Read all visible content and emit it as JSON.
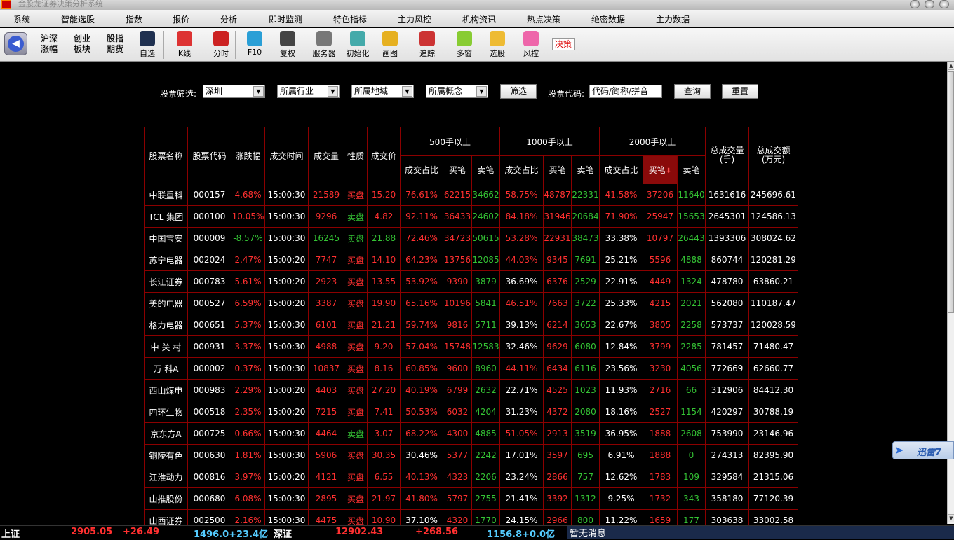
{
  "window": {
    "title": "金股龙证券决策分析系统"
  },
  "menu": [
    "系统",
    "智能选股",
    "指数",
    "报价",
    "分析",
    "即时监测",
    "特色指标",
    "主力风控",
    "机构资讯",
    "热点决策",
    "绝密数据",
    "主力数据"
  ],
  "toolbar": {
    "back_icon": "back-arrow-icon",
    "text_buttons": [
      {
        "label": "沪深\n涨幅"
      },
      {
        "label": "创业\n板块"
      },
      {
        "label": "股指\n期货"
      }
    ],
    "buttons": [
      {
        "label": "自选",
        "icon": "monitor-icon",
        "color": "#1f3050"
      },
      {
        "label": "K线",
        "icon": "candlestick-icon",
        "color": "#d33"
      },
      {
        "label": "分时",
        "icon": "line-chart-icon",
        "color": "#c22"
      },
      {
        "label": "F10",
        "icon": "snowflake-icon",
        "color": "#2a9fd6"
      },
      {
        "label": "复权",
        "icon": "printer-icon",
        "color": "#444"
      },
      {
        "label": "服务器",
        "icon": "gauge-icon",
        "color": "#777"
      },
      {
        "label": "初始化",
        "icon": "layers-icon",
        "color": "#4aa"
      },
      {
        "label": "画图",
        "icon": "palette-icon",
        "color": "#e6b020"
      },
      {
        "label": "追踪",
        "icon": "trend-icon",
        "color": "#c33"
      },
      {
        "label": "多窗",
        "icon": "globe-icon",
        "color": "#8c3"
      },
      {
        "label": "选股",
        "icon": "sparkle-icon",
        "color": "#eb3"
      },
      {
        "label": "风控",
        "icon": "target-icon",
        "color": "#e6a"
      }
    ],
    "decision_label": "决策"
  },
  "filter": {
    "screen_label": "股票筛选:",
    "market_select": "深圳",
    "industry_select": "所属行业",
    "region_select": "所属地域",
    "concept_select": "所属概念",
    "filter_button": "筛选",
    "code_label": "股票代码:",
    "code_placeholder": "代码/简称/拼音",
    "query_button": "查询",
    "reset_button": "重置"
  },
  "table": {
    "headers": {
      "name": "股票名称",
      "code": "股票代码",
      "change": "涨跌幅",
      "time": "成交时间",
      "volume": "成交量",
      "nature": "性质",
      "price": "成交价",
      "g500": "500手以上",
      "g1000": "1000手以上",
      "g2000": "2000手以上",
      "ratio": "成交占比",
      "buy": "买笔",
      "sell": "卖笔",
      "sort_arrow": "⬇",
      "total_vol": "总成交量\n(手)",
      "total_amt": "总成交额\n(万元)"
    },
    "rows": [
      [
        "中联重科",
        "000157",
        "4.68%",
        "15:00:30",
        "21589",
        "买盘",
        "15.20",
        "76.61%",
        "62215",
        "34662",
        "58.75%",
        "48787",
        "22331",
        "41.58%",
        "37206",
        "11640",
        "1631616",
        "245696.61"
      ],
      [
        "TCL 集团",
        "000100",
        "10.05%",
        "15:00:30",
        "9296",
        "卖盘",
        "4.82",
        "92.11%",
        "36433",
        "24602",
        "84.18%",
        "31946",
        "20684",
        "71.90%",
        "25947",
        "15653",
        "2645301",
        "124586.13"
      ],
      [
        "中国宝安",
        "000009",
        "-8.57%",
        "15:00:30",
        "16245",
        "卖盘",
        "21.88",
        "72.46%",
        "34723",
        "50615",
        "53.28%",
        "22931",
        "38473",
        "33.38%",
        "10797",
        "26443",
        "1393306",
        "308024.62"
      ],
      [
        "苏宁电器",
        "002024",
        "2.47%",
        "15:00:20",
        "7747",
        "买盘",
        "14.10",
        "64.23%",
        "13756",
        "12085",
        "44.03%",
        "9345",
        "7691",
        "25.21%",
        "5596",
        "4888",
        "860744",
        "120281.29"
      ],
      [
        "长江证券",
        "000783",
        "5.61%",
        "15:00:20",
        "2923",
        "买盘",
        "13.55",
        "53.92%",
        "9390",
        "3879",
        "36.69%",
        "6376",
        "2529",
        "22.91%",
        "4449",
        "1324",
        "478780",
        "63860.21"
      ],
      [
        "美的电器",
        "000527",
        "6.59%",
        "15:00:20",
        "3387",
        "买盘",
        "19.90",
        "65.16%",
        "10196",
        "5841",
        "46.51%",
        "7663",
        "3722",
        "25.33%",
        "4215",
        "2021",
        "562080",
        "110187.47"
      ],
      [
        "格力电器",
        "000651",
        "5.37%",
        "15:00:30",
        "6101",
        "买盘",
        "21.21",
        "59.74%",
        "9816",
        "5711",
        "39.13%",
        "6214",
        "3653",
        "22.67%",
        "3805",
        "2258",
        "573737",
        "120028.59"
      ],
      [
        "中 关 村",
        "000931",
        "3.37%",
        "15:00:30",
        "4988",
        "买盘",
        "9.20",
        "57.04%",
        "15748",
        "12583",
        "32.46%",
        "9629",
        "6080",
        "12.84%",
        "3799",
        "2285",
        "781457",
        "71480.47"
      ],
      [
        "万 科A",
        "000002",
        "0.37%",
        "15:00:30",
        "10837",
        "买盘",
        "8.16",
        "60.85%",
        "9600",
        "8960",
        "44.11%",
        "6434",
        "6116",
        "23.56%",
        "3230",
        "4056",
        "772669",
        "62660.77"
      ],
      [
        "西山煤电",
        "000983",
        "2.29%",
        "15:00:20",
        "4403",
        "买盘",
        "27.20",
        "40.19%",
        "6799",
        "2632",
        "22.71%",
        "4525",
        "1023",
        "11.93%",
        "2716",
        "66",
        "312906",
        "84412.30"
      ],
      [
        "四环生物",
        "000518",
        "2.35%",
        "15:00:20",
        "7215",
        "买盘",
        "7.41",
        "50.53%",
        "6032",
        "4204",
        "31.23%",
        "4372",
        "2080",
        "18.16%",
        "2527",
        "1154",
        "420297",
        "30788.19"
      ],
      [
        "京东方A",
        "000725",
        "0.66%",
        "15:00:30",
        "4464",
        "卖盘",
        "3.07",
        "68.22%",
        "4300",
        "4885",
        "51.05%",
        "2913",
        "3519",
        "36.95%",
        "1888",
        "2608",
        "753990",
        "23146.96"
      ],
      [
        "铜陵有色",
        "000630",
        "1.81%",
        "15:00:30",
        "5906",
        "买盘",
        "30.35",
        "30.46%",
        "5377",
        "2242",
        "17.01%",
        "3597",
        "695",
        "6.91%",
        "1888",
        "0",
        "274313",
        "82395.90"
      ],
      [
        "江淮动力",
        "000816",
        "3.97%",
        "15:00:20",
        "4121",
        "买盘",
        "6.55",
        "40.13%",
        "4323",
        "2206",
        "23.24%",
        "2866",
        "757",
        "12.62%",
        "1783",
        "109",
        "329584",
        "21315.06"
      ],
      [
        "山推股份",
        "000680",
        "6.08%",
        "15:00:30",
        "2895",
        "买盘",
        "21.97",
        "41.80%",
        "5797",
        "2755",
        "21.41%",
        "3392",
        "1312",
        "9.25%",
        "1732",
        "343",
        "358180",
        "77120.39"
      ],
      [
        "山西证券",
        "002500",
        "2.16%",
        "15:00:30",
        "4475",
        "买盘",
        "10.90",
        "37.10%",
        "4320",
        "1770",
        "24.15%",
        "2966",
        "800",
        "11.22%",
        "1659",
        "177",
        "303638",
        "33002.58"
      ]
    ]
  },
  "status": {
    "sh_label": "上证",
    "sh_index": "2905.05",
    "sh_change": "+26.49",
    "sh_amount": "1496.0+23.4亿",
    "sz_label": "深证",
    "sz_index": "12902.43",
    "sz_change": "+268.56",
    "sz_amount": "1156.8+0.0亿",
    "message": "暂无消息"
  },
  "thunder": {
    "label": "迅雷7"
  }
}
